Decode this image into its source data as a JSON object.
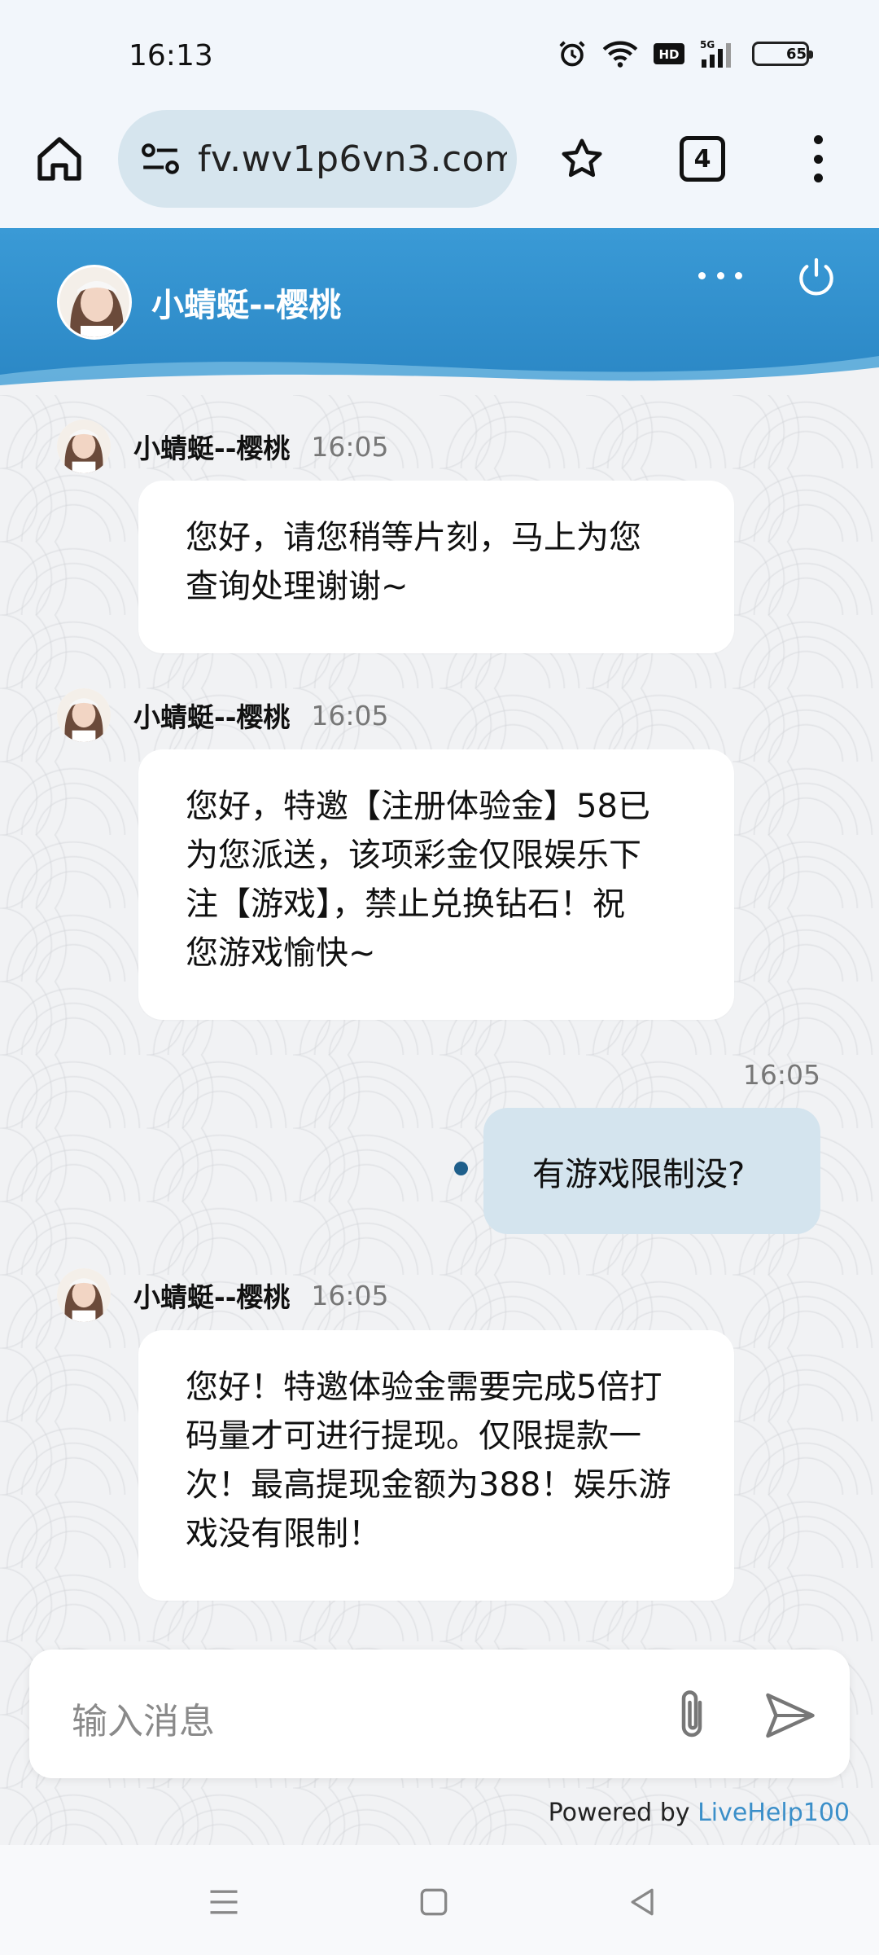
{
  "status_bar": {
    "time": "16:13",
    "battery_level": "65",
    "icons": [
      "alarm-icon",
      "wifi-icon",
      "hd-icon",
      "5g-signal-icon",
      "battery-icon"
    ]
  },
  "browser": {
    "url": "fv.wv1p6vn3.com",
    "tab_count": "4"
  },
  "chat": {
    "agent_name": "小蜻蜓--樱桃",
    "messages": [
      {
        "sender": "小蜻蜓--樱桃",
        "time": "16:05",
        "lines": [
          "您好，请您稍等片刻，马上为您",
          "查询处理谢谢~"
        ]
      },
      {
        "sender": "小蜻蜓--樱桃",
        "time": "16:05",
        "lines": [
          "您好，特邀【注册体验金】58已",
          "为您派送，该项彩金仅限娱乐下",
          "注【游戏】，禁止兑换钻石！祝",
          "您游戏愉快~"
        ]
      },
      {
        "sender": "user",
        "time": "16:05",
        "text": "有游戏限制没?"
      },
      {
        "sender": "小蜻蜓--樱桃",
        "time": "16:05",
        "lines": [
          "您好！特邀体验金需要完成5倍打",
          "码量才可进行提现。仅限提款一",
          "次！最高提现金额为388！娱乐游",
          "戏没有限制！"
        ]
      }
    ],
    "input_placeholder": "输入消息",
    "powered_by_prefix": "Powered by ",
    "powered_by_brand": "LiveHelp100"
  },
  "colors": {
    "header_blue": "#2a86c4",
    "user_bubble": "#d4e4ee",
    "brand_link": "#3b8fc9"
  }
}
